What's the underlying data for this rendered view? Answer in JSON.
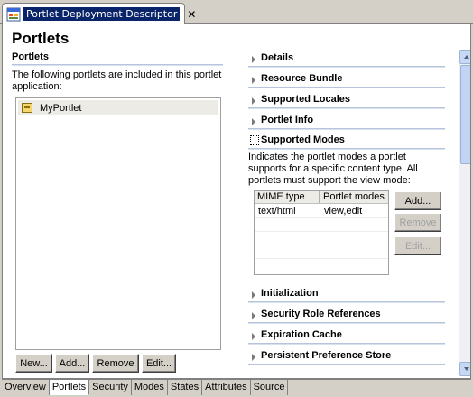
{
  "editor_tab": {
    "title": "Portlet Deployment Descriptor",
    "close": "✕"
  },
  "page": {
    "title": "Portlets"
  },
  "left": {
    "section_title": "Portlets",
    "description": "The following portlets are included in this portlet application:",
    "portlets": [
      "MyPortlet"
    ],
    "buttons": {
      "new": "New...",
      "add": "Add...",
      "remove": "Remove",
      "edit": "Edit..."
    }
  },
  "right": {
    "sections_top": [
      "Details",
      "Resource Bundle",
      "Supported Locales",
      "Portlet Info"
    ],
    "supported_modes": {
      "title": "Supported Modes",
      "description": "Indicates the portlet modes a portlet supports for a specific content type. All portlets must support the view mode:",
      "columns": [
        "MIME type",
        "Portlet modes"
      ],
      "rows": [
        {
          "mime": "text/html",
          "modes": "view,edit"
        }
      ],
      "buttons": {
        "add": "Add...",
        "remove": "Remove",
        "edit": "Edit..."
      }
    },
    "sections_bottom": [
      "Initialization",
      "Security Role References",
      "Expiration Cache",
      "Persistent Preference Store"
    ]
  },
  "bottom_tabs": [
    "Overview",
    "Portlets",
    "Security",
    "Modes",
    "States",
    "Attributes",
    "Source"
  ],
  "active_tab": "Portlets",
  "colors": {
    "selection": "#0a246a",
    "section_rule": "#a5b8d3",
    "scrollbar": "#c3d3f3"
  }
}
